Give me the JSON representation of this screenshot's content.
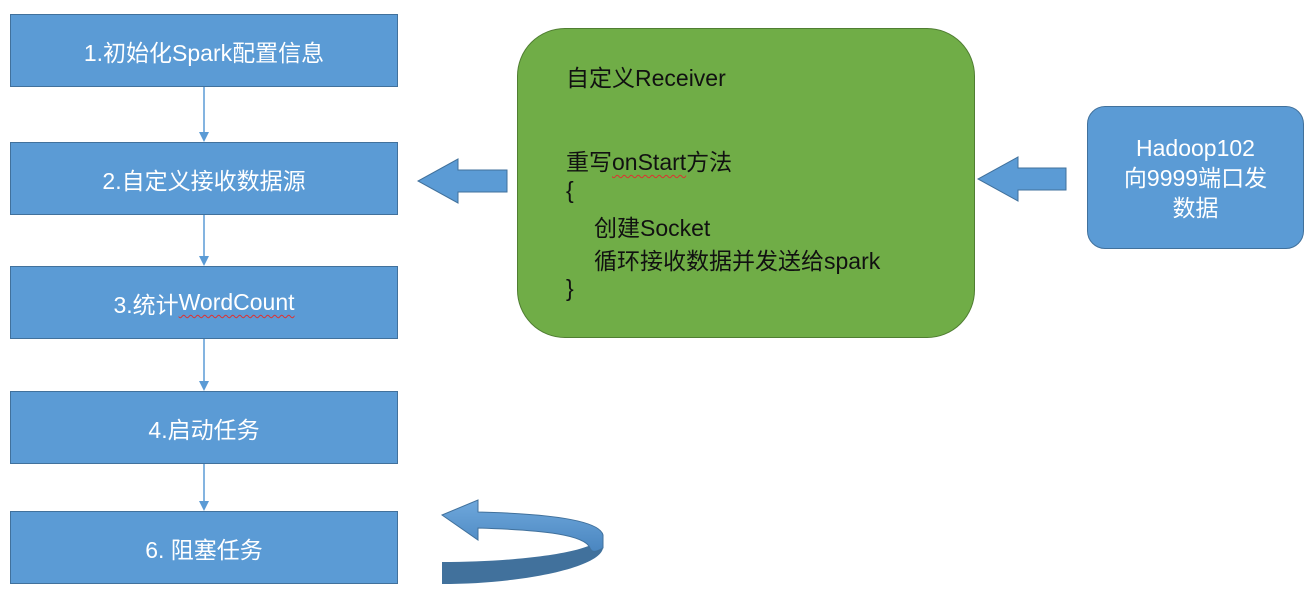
{
  "steps": [
    {
      "label": "1.初始化Spark配置信息"
    },
    {
      "label": "2.自定义接收数据源"
    },
    {
      "label_prefix": "3.统计",
      "label_word": "WordCount"
    },
    {
      "label": "4.启动任务"
    },
    {
      "label": "6. 阻塞任务"
    }
  ],
  "receiver": {
    "title": "自定义Receiver",
    "method_word": "onStart",
    "method_prefix": "重写",
    "method_suffix": "方法",
    "open_brace": "{",
    "line1": "创建Socket",
    "line2": "循环接收数据并发送给spark",
    "close_brace": "}"
  },
  "hadoop": {
    "line1": "Hadoop102",
    "line2": "向9999端口发",
    "line3": "数据"
  },
  "colors": {
    "step_fill": "#5b9bd5",
    "receiver_fill": "#70ad47",
    "arrow_fill": "#5b9bd5"
  }
}
